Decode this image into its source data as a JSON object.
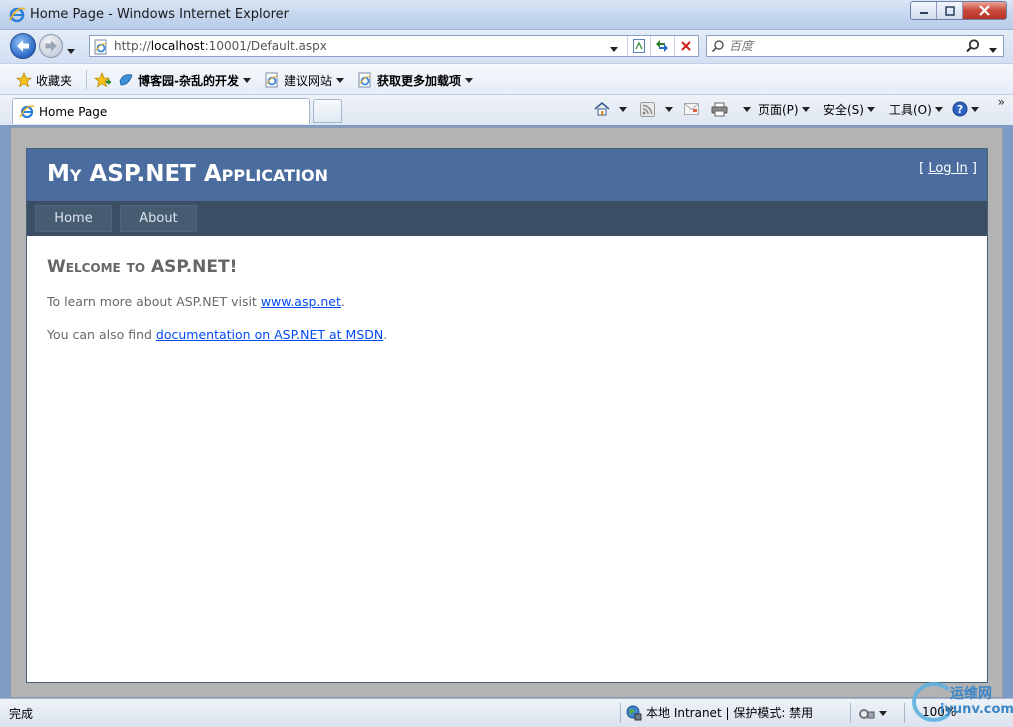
{
  "window": {
    "title": "Home Page - Windows Internet Explorer"
  },
  "address": {
    "url_prefix": "http://",
    "url_host": "localhost",
    "url_rest": ":10001/Default.aspx",
    "search_placeholder": "百度"
  },
  "favorites": {
    "favorites_label": "收藏夹",
    "items": [
      {
        "label": "博客园-杂乱的开发"
      },
      {
        "label": "建议网站"
      },
      {
        "label": "获取更多加载项"
      }
    ]
  },
  "tabs": [
    {
      "label": "Home Page"
    }
  ],
  "commandbar": {
    "page_label": "页面(P)",
    "safety_label": "安全(S)",
    "tools_label": "工具(O)"
  },
  "site": {
    "title": "My ASP.NET Application",
    "login_open": "[ ",
    "login_link": "Log In",
    "login_close": " ]",
    "menu": [
      {
        "label": "Home"
      },
      {
        "label": "About"
      }
    ],
    "heading": "Welcome to ASP.NET!",
    "para1_text": "To learn more about ASP.NET visit ",
    "para1_link": "www.asp.net",
    "para1_end": ".",
    "para2_text": "You can also find ",
    "para2_link": "documentation on ASP.NET at MSDN",
    "para2_end": "."
  },
  "status": {
    "text": "完成",
    "zone": "本地 Intranet | 保护模式: 禁用",
    "zoom": "100%"
  },
  "watermark": {
    "line1": "运维网",
    "line2": "iyunv.com"
  }
}
